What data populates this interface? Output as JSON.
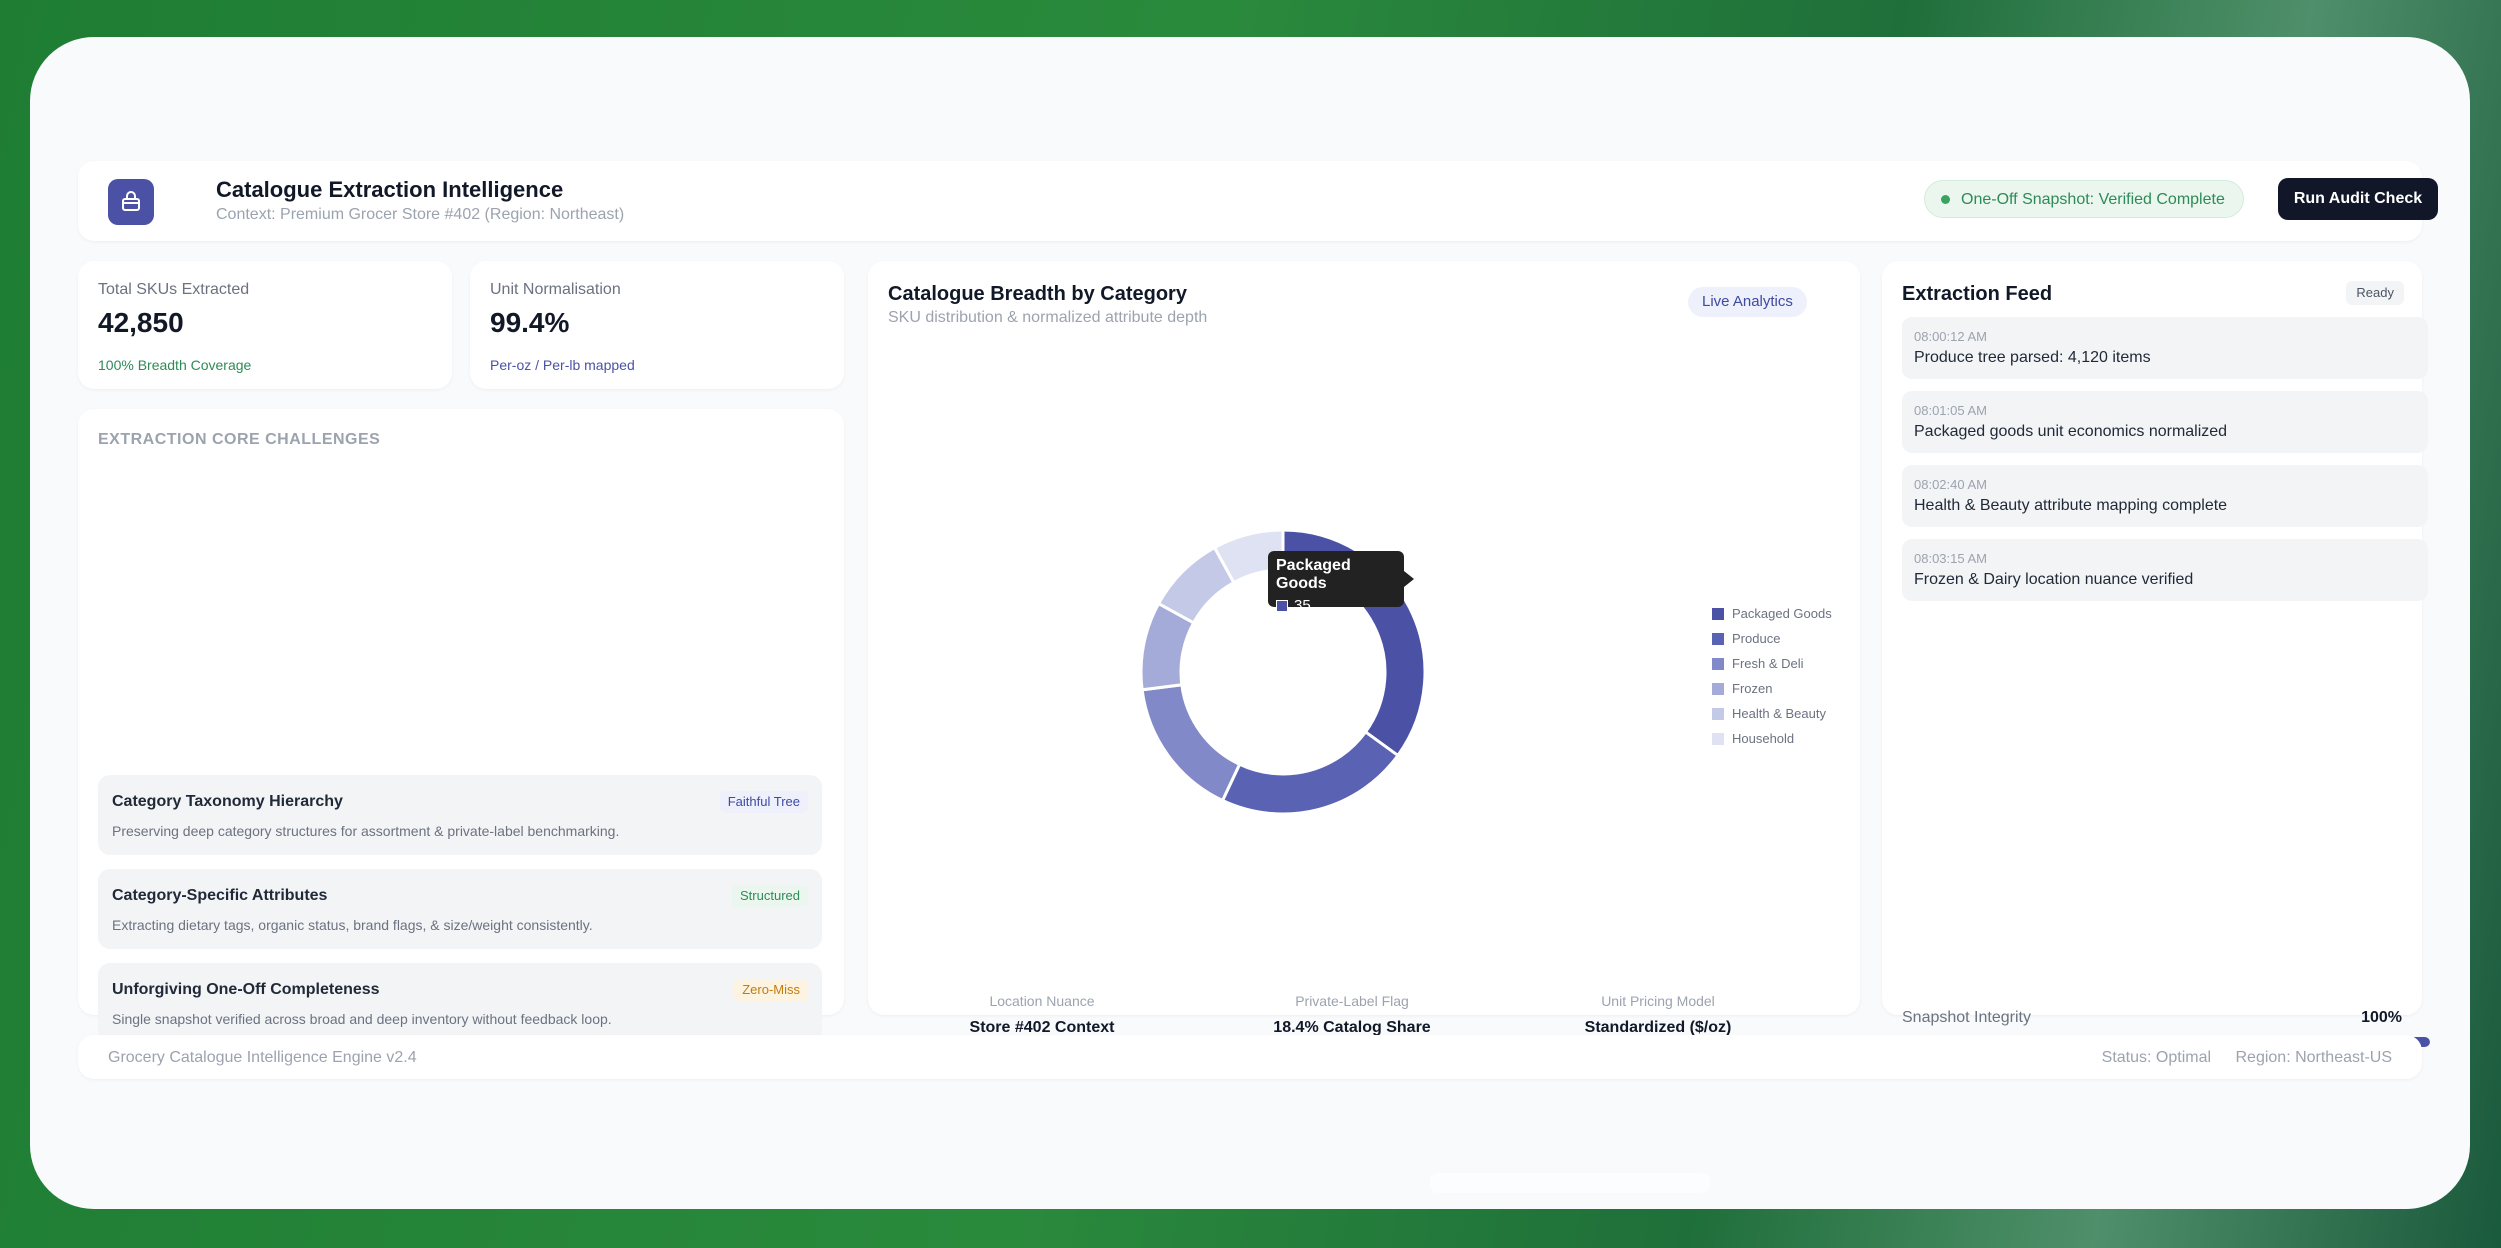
{
  "header": {
    "title": "Catalogue Extraction Intelligence",
    "context": "Context: Premium Grocer Store #402 (Region: Northeast)",
    "snapshot_status": "One-Off Snapshot: Verified Complete",
    "run_button": "Run Audit Check",
    "icon": "storefront-icon"
  },
  "kpis": [
    {
      "label": "Total SKUs Extracted",
      "value": "42,850",
      "note": "100% Breadth Coverage",
      "note_color": "#2e8b57"
    },
    {
      "label": "Unit Normalisation",
      "value": "99.4%",
      "note": "Per-oz / Per-lb mapped",
      "note_color": "#4b52a6"
    }
  ],
  "challenges": {
    "section_label": "EXTRACTION CORE CHALLENGES",
    "items": [
      {
        "title": "Category Taxonomy Hierarchy",
        "description": "Preserving deep category structures for assortment & private-label benchmarking.",
        "badge": "Faithful Tree",
        "badge_color": "#3f4aa0",
        "badge_bg": "#eef0fb"
      },
      {
        "title": "Category-Specific Attributes",
        "description": "Extracting dietary tags, organic status, brand flags, & size/weight consistently.",
        "badge": "Structured",
        "badge_color": "#2e8b57",
        "badge_bg": "#eaf6ee"
      },
      {
        "title": "Unforgiving One-Off Completeness",
        "description": "Single snapshot verified across broad and deep inventory without feedback loop.",
        "badge": "Zero-Miss",
        "badge_color": "#c27c0e",
        "badge_bg": "#fdf3e1"
      }
    ]
  },
  "chart": {
    "title": "Catalogue Breadth by Category",
    "subtitle": "SKU distribution & normalized attribute depth",
    "badge": "Live Analytics",
    "tooltip": {
      "name": "Packaged Goods",
      "value": "35"
    }
  },
  "chart_data": {
    "type": "pie",
    "donut": true,
    "categories": [
      "Packaged Goods",
      "Produce",
      "Fresh & Deli",
      "Frozen",
      "Health & Beauty",
      "Household"
    ],
    "values": [
      35,
      22,
      16,
      10,
      9,
      8
    ],
    "colors": [
      "#4b52a6",
      "#5a62b3",
      "#8289c8",
      "#a5abd9",
      "#c5c9e8",
      "#dfe2f3"
    ],
    "legend": "right"
  },
  "chart_stats": [
    {
      "label": "Location Nuance",
      "value": "Store #402 Context"
    },
    {
      "label": "Private-Label Flag",
      "value": "18.4% Catalog Share"
    },
    {
      "label": "Unit Pricing Model",
      "value": "Standardized ($/oz)"
    }
  ],
  "feed": {
    "title": "Extraction Feed",
    "badge": "Ready",
    "items": [
      {
        "time": "08:00:12 AM",
        "message": "Produce tree parsed: 4,120 items"
      },
      {
        "time": "08:01:05 AM",
        "message": "Packaged goods unit economics normalized"
      },
      {
        "time": "08:02:40 AM",
        "message": "Health & Beauty attribute mapping complete"
      },
      {
        "time": "08:03:15 AM",
        "message": "Frozen & Dairy location nuance verified"
      }
    ],
    "integrity_label": "Snapshot Integrity",
    "integrity_value": "100%",
    "integrity_fraction": 1.0
  },
  "footer": {
    "engine": "Grocery Catalogue Intelligence Engine v2.4",
    "status": "Status: Optimal",
    "region": "Region: Northeast-US"
  }
}
